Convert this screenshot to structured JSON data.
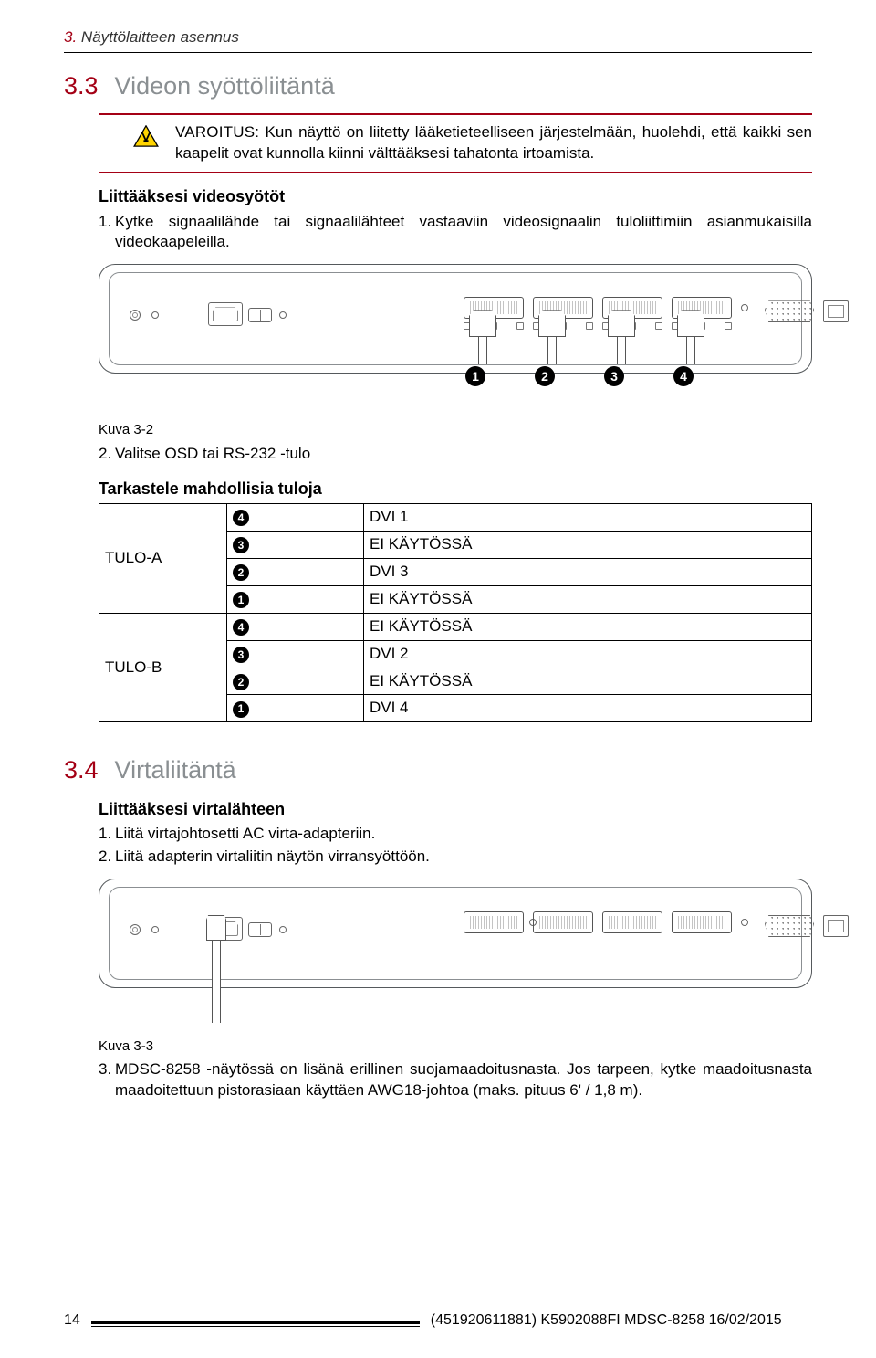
{
  "header": {
    "secnum": "3.",
    "title": "Näyttölaitteen asennus"
  },
  "sec33": {
    "num": "3.3",
    "title": "Videon syöttöliitäntä",
    "warningLabel": "VAROITUS:",
    "warningText": " Kun näyttö on liitetty lääketieteelliseen järjestelmään, huolehdi, että kaikki sen kaapelit ovat kunnolla kiinni välttääksesi tahatonta irtoamista.",
    "sub1": "Liittääksesi videosyötöt",
    "step1": "Kytke signaalilähde tai signaalilähteet vastaaviin videosignaalin tuloliittimiin asianmukaisilla videokaapeleilla.",
    "fig": "Kuva 3-2",
    "step2num": "2.",
    "step2": "Valitse OSD tai RS-232 -tulo",
    "tableHead": "Tarkastele mahdollisia tuloja",
    "badges": [
      "1",
      "2",
      "3",
      "4"
    ],
    "table": {
      "rows": [
        {
          "g": "TULO-A",
          "b": "4",
          "v": "DVI 1"
        },
        {
          "g": "",
          "b": "3",
          "v": "EI KÄYTÖSSÄ"
        },
        {
          "g": "",
          "b": "2",
          "v": "DVI 3"
        },
        {
          "g": "",
          "b": "1",
          "v": "EI KÄYTÖSSÄ"
        },
        {
          "g": "TULO-B",
          "b": "4",
          "v": "EI KÄYTÖSSÄ"
        },
        {
          "g": "",
          "b": "3",
          "v": "DVI 2"
        },
        {
          "g": "",
          "b": "2",
          "v": "EI KÄYTÖSSÄ"
        },
        {
          "g": "",
          "b": "1",
          "v": "DVI 4"
        }
      ]
    }
  },
  "sec34": {
    "num": "3.4",
    "title": "Virtaliitäntä",
    "sub": "Liittääksesi virtalähteen",
    "step1": "Liitä virtajohtosetti AC virta-adapteriin.",
    "step2": "Liitä adapterin virtaliitin näytön virransyöttöön.",
    "fig": "Kuva 3-3",
    "step3num": "3.",
    "step3": "MDSC-8258 -näytössä on lisänä erillinen suojamaadoitusnasta.  Jos tarpeen, kytke maadoitusnasta maadoitettuun pistorasiaan käyttäen AWG18-johtoa (maks.  pituus 6' / 1,8 m)."
  },
  "footer": {
    "page": "14",
    "doc": "(451920611881) K5902088FI  MDSC-8258  16/02/2015"
  },
  "nums": {
    "one": "1.",
    "two": "2."
  }
}
